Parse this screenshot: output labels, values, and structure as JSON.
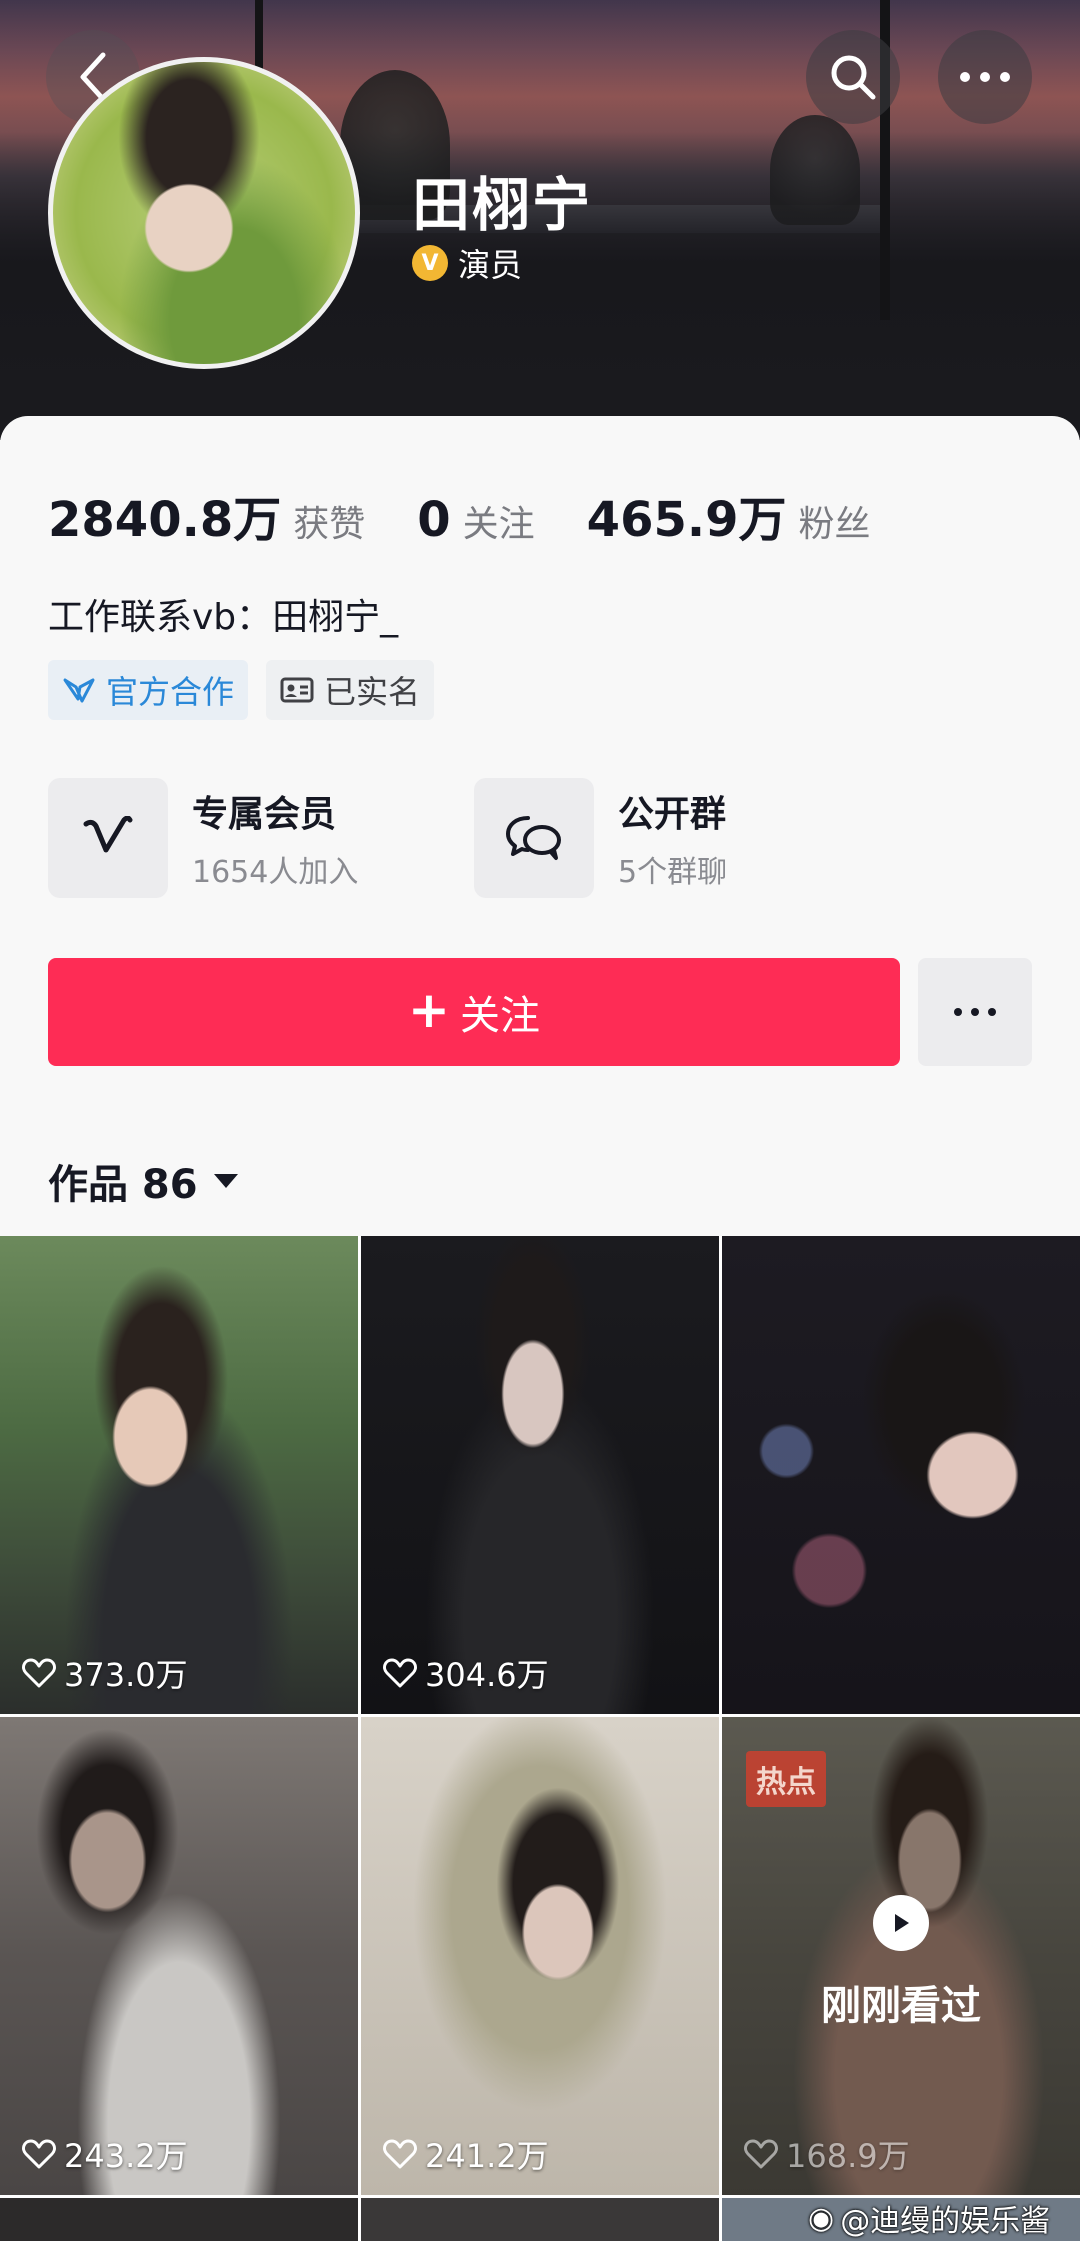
{
  "profile": {
    "name": "田栩宁",
    "verify_badge": "V",
    "verify_label": "演员"
  },
  "stats": [
    {
      "value": "2840.8万",
      "label": "获赞"
    },
    {
      "value": "0",
      "label": "关注"
    },
    {
      "value": "465.9万",
      "label": "粉丝"
    }
  ],
  "bio": "工作联系vb：田栩宁_",
  "tags": [
    {
      "label": "官方合作",
      "icon": "cooperation-icon"
    },
    {
      "label": "已实名",
      "icon": "id-card-icon"
    }
  ],
  "features": [
    {
      "title": "专属会员",
      "subtitle": "1654人加入",
      "icon": "membership-v-icon"
    },
    {
      "title": "公开群",
      "subtitle": "5个群聊",
      "icon": "group-chat-icon"
    }
  ],
  "follow_button": {
    "label": "关注"
  },
  "works_tab": {
    "label": "作品 86"
  },
  "videos": [
    {
      "likes": "373.0万"
    },
    {
      "likes": "304.6万"
    },
    {
      "likes": ""
    },
    {
      "likes": "243.2万"
    },
    {
      "likes": "241.2万"
    },
    {
      "likes": "168.9万",
      "badge": "热点",
      "overlay": "刚刚看过"
    }
  ],
  "watermark": "@迪缦的娱乐酱",
  "colors": {
    "accent": "#fe2c55",
    "verify": "#f2b733",
    "link_blue": "#2a88d8"
  }
}
